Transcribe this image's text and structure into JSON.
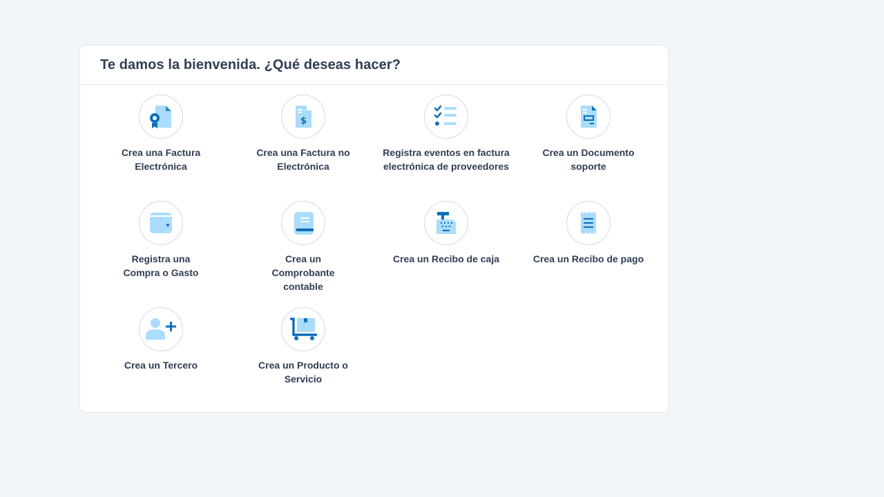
{
  "header": {
    "title": "Te damos la bienvenida. ¿Qué deseas hacer?"
  },
  "colors": {
    "icon_dark": "#0b6fba",
    "icon_light": "#aadcfb",
    "text": "#2e3d54",
    "background": "#f3f6f9"
  },
  "actions": [
    {
      "label": "Crea una Factura Electrónica",
      "icon": "electronic-invoice-icon"
    },
    {
      "label": "Crea una Factura no Electrónica",
      "icon": "non-electronic-invoice-icon"
    },
    {
      "label": "Registra eventos en factura electrónica de proveedores",
      "icon": "checklist-icon"
    },
    {
      "label": "Crea un Documento soporte",
      "icon": "support-document-icon"
    },
    {
      "label": "Registra una Compra o Gasto",
      "icon": "wallet-icon"
    },
    {
      "label": "Crea un Comprobante contable",
      "icon": "accounting-voucher-icon"
    },
    {
      "label": "Crea un Recibo de caja",
      "icon": "cash-register-icon"
    },
    {
      "label": "Crea un Recibo de pago",
      "icon": "payment-receipt-icon"
    },
    {
      "label": "Crea un Tercero",
      "icon": "add-person-icon"
    },
    {
      "label": "Crea un Producto o Servicio",
      "icon": "product-cart-icon"
    }
  ]
}
